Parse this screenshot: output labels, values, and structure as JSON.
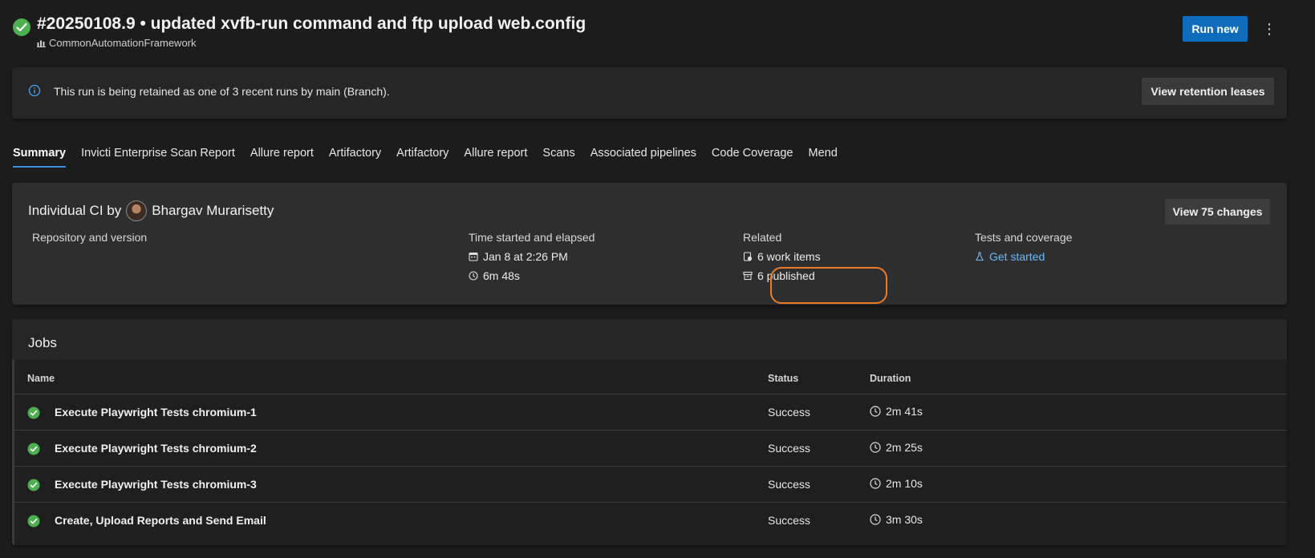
{
  "header": {
    "title": "#20250108.9 • updated xvfb-run command and ftp upload web.config",
    "project": "CommonAutomationFramework",
    "run_new_label": "Run new",
    "more_label": "⋮"
  },
  "banner": {
    "text": "This run is being retained as one of 3 recent runs by main (Branch).",
    "button_label": "View retention leases"
  },
  "tabs": [
    {
      "label": "Summary"
    },
    {
      "label": "Invicti Enterprise Scan Report"
    },
    {
      "label": "Allure report"
    },
    {
      "label": "Artifactory"
    },
    {
      "label": "Artifactory"
    },
    {
      "label": "Allure report"
    },
    {
      "label": "Scans"
    },
    {
      "label": "Associated pipelines"
    },
    {
      "label": "Code Coverage"
    },
    {
      "label": "Mend"
    }
  ],
  "summary": {
    "trigger": "Individual CI by",
    "user": "Bhargav Murarisetty",
    "changes_button": "View 75 changes",
    "repo_header": "Repository and version",
    "time_header": "Time started and elapsed",
    "started": "Jan 8 at 2:26 PM",
    "elapsed": "6m 48s",
    "related_header": "Related",
    "work_items": "6 work items",
    "published": "6 published",
    "tests_header": "Tests and coverage",
    "get_started": "Get started"
  },
  "jobs": {
    "title": "Jobs",
    "col_name": "Name",
    "col_status": "Status",
    "col_duration": "Duration",
    "rows": [
      {
        "name": "Execute Playwright Tests chromium-1",
        "status": "Success",
        "duration": "2m 41s"
      },
      {
        "name": "Execute Playwright Tests chromium-2",
        "status": "Success",
        "duration": "2m 25s"
      },
      {
        "name": "Execute Playwright Tests chromium-3",
        "status": "Success",
        "duration": "2m 10s"
      },
      {
        "name": "Create, Upload Reports and Send Email",
        "status": "Success",
        "duration": "3m 30s"
      }
    ]
  },
  "colors": {
    "success": "#4caf50",
    "primary_button": "#0f6cbd",
    "link": "#6cb8f6",
    "highlight": "#e87b2a"
  }
}
